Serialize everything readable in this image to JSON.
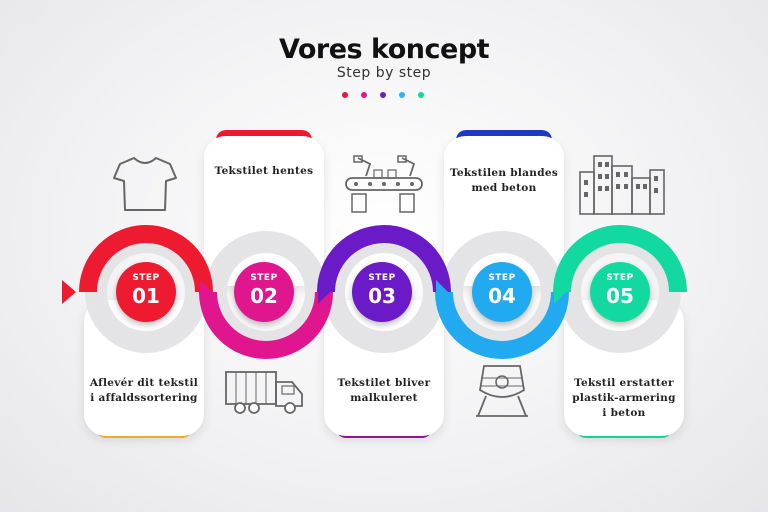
{
  "header": {
    "title": "Vores koncept",
    "subtitle": "Step by step"
  },
  "dots": [
    "#e6173a",
    "#e0148c",
    "#6a1fc2",
    "#2ab4f2",
    "#12d6a0"
  ],
  "steps": [
    {
      "label": "STEP",
      "number": "01",
      "color": "#ee1a2f",
      "text_lines": [
        "Aflevér dit tekstil",
        "i affaldssortering"
      ],
      "icon": "t-shirt-icon"
    },
    {
      "label": "STEP",
      "number": "02",
      "color": "#e0168f",
      "text_lines": [
        "Tekstilet hentes"
      ],
      "icon": "truck-icon"
    },
    {
      "label": "STEP",
      "number": "03",
      "color": "#6b1ac8",
      "text_lines": [
        "Tekstilet bliver",
        "malkuleret"
      ],
      "icon": "factory-conveyor-icon"
    },
    {
      "label": "STEP",
      "number": "04",
      "color": "#22aaf0",
      "text_lines": [
        "Tekstilen blandes",
        "med beton"
      ],
      "icon": "cement-mixer-icon"
    },
    {
      "label": "STEP",
      "number": "05",
      "color": "#12d9a0",
      "text_lines": [
        "Tekstil erstatter",
        "plastik-armering",
        "i beton"
      ],
      "icon": "buildings-icon"
    }
  ],
  "card_accents": [
    "#fdbb1b",
    "#ee1a2f",
    "#a0159a",
    "#1d3bc4",
    "#12e6a0"
  ]
}
